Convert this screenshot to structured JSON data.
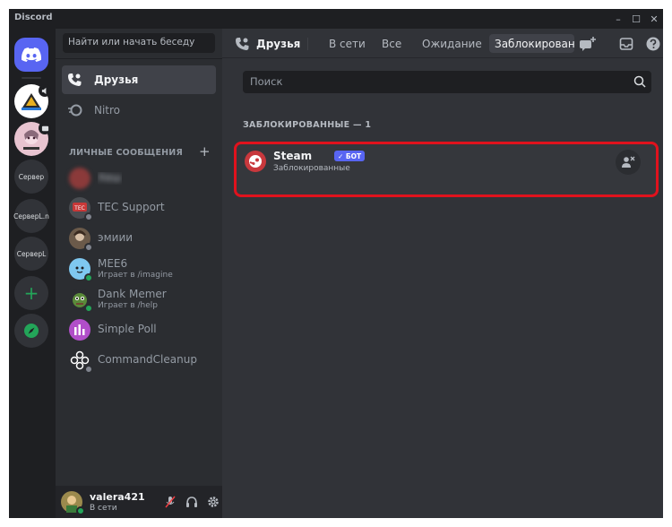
{
  "app": {
    "title": "Discord"
  },
  "window_controls": {
    "minimize": "–",
    "maximize": "☐",
    "close": "✕"
  },
  "guilds": [
    {
      "name": "discord-home",
      "label": ""
    },
    {
      "name": "server-1",
      "label": ""
    },
    {
      "name": "server-2",
      "label": ""
    },
    {
      "name": "server-3",
      "label": "Сервер"
    },
    {
      "name": "server-4",
      "label": "СерверL.n"
    },
    {
      "name": "server-5",
      "label": "СерверL"
    },
    {
      "name": "add-server",
      "label": "+"
    }
  ],
  "dm_sidebar": {
    "search_placeholder": "Найти или начать беседу",
    "nav": {
      "friends": "Друзья",
      "nitro": "Nitro"
    },
    "section_title": "ЛИЧНЫЕ СООБЩЕНИЯ",
    "add": "+",
    "items": [
      {
        "name": "Хеш",
        "sub": "",
        "status": "offline",
        "blurred": true,
        "avatar_color": "#8b3a3a"
      },
      {
        "name": "TEC Support",
        "sub": "",
        "status": "offline",
        "blurred": false,
        "avatar_color": "#4a4d52"
      },
      {
        "name": "эмиии",
        "sub": "",
        "status": "offline",
        "blurred": false,
        "avatar_color": "#6b5a4a"
      },
      {
        "name": "MEE6",
        "sub": "Играет в /imagine",
        "status": "online",
        "blurred": false,
        "avatar_color": "#7fc8f0"
      },
      {
        "name": "Dank Memer",
        "sub": "Играет в /help",
        "status": "online",
        "blurred": false,
        "avatar_color": "#5a8a3a"
      },
      {
        "name": "Simple Poll",
        "sub": "",
        "status": "none",
        "blurred": false,
        "avatar_color": "#b14ec9"
      },
      {
        "name": "CommandCleanup",
        "sub": "",
        "status": "offline",
        "blurred": false,
        "avatar_color": "#2b2d31"
      }
    ]
  },
  "user_panel": {
    "username": "valera421",
    "status": "В сети"
  },
  "topbar": {
    "title": "Друзья",
    "tabs": [
      {
        "label": "В сети",
        "active": false
      },
      {
        "label": "Все",
        "active": false
      },
      {
        "label": "Ожидание",
        "active": false
      },
      {
        "label": "Заблокированные",
        "active": true
      }
    ]
  },
  "main": {
    "search_placeholder": "Поиск",
    "section_label": "ЗАБЛОКИРОВАННЫЕ — 1",
    "blocked": [
      {
        "name": "Steam",
        "badge": "✓ БОТ",
        "sub": "Заблокированные"
      }
    ]
  },
  "colors": {
    "accent": "#5865f2",
    "highlight_border": "#e0121d",
    "online": "#23a559",
    "offline": "#80848e"
  }
}
